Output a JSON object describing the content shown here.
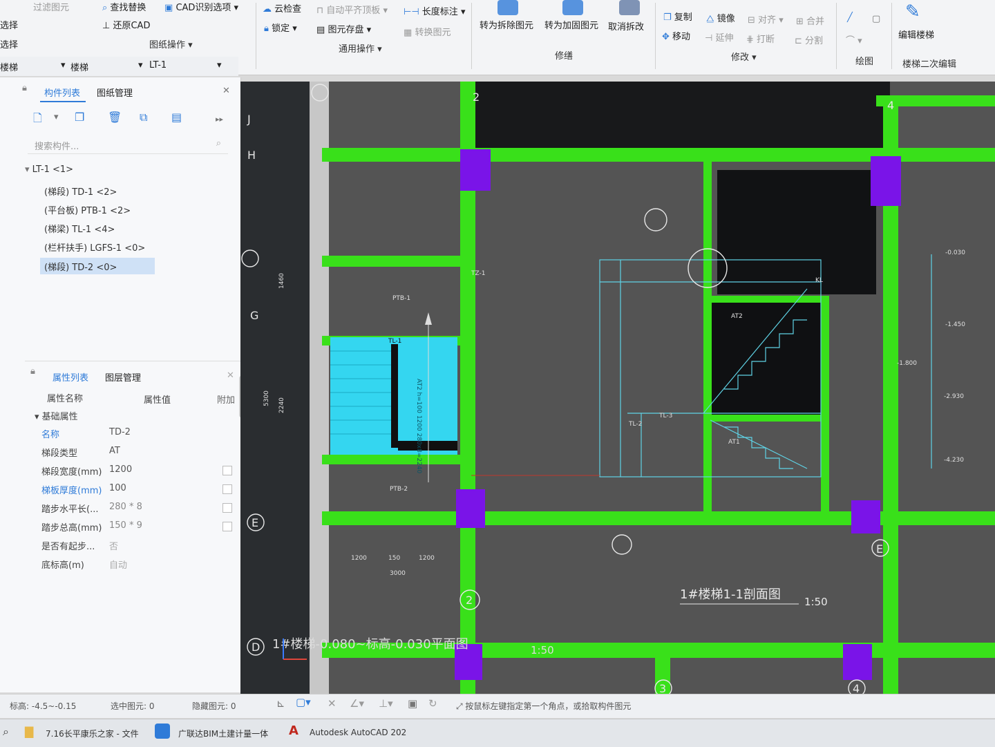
{
  "ribbon": {
    "top_left": [
      "过滤图元",
      "选择",
      "选择"
    ],
    "find_replace": "查找替换",
    "cad_options": "CAD识别选项",
    "restore_cad": "还原CAD",
    "drawing_ops": "图纸操作",
    "cloud_check": "云检查",
    "auto_slab": "自动平齐顶板",
    "length_dim": "长度标注",
    "lock": "锁定",
    "save_element": "图元存盘",
    "convert_element": "转换图元",
    "common_ops": "通用操作",
    "to_demolish": "转为拆除图元",
    "to_reinforce": "转为加固图元",
    "cancel_demolish": "取消拆改",
    "repair_group": "修缮",
    "copy": "复制",
    "mirror": "镜像",
    "align": "对齐",
    "merge": "合并",
    "move": "移动",
    "extend": "延伸",
    "break": "打断",
    "split": "分割",
    "modify_group": "修改",
    "draw_group": "绘图",
    "edit_stair": "编辑楼梯",
    "stair_edit_group": "楼梯二次编辑"
  },
  "selectors": {
    "type_partial": "楼梯",
    "category": "楼梯",
    "component": "LT-1"
  },
  "component_panel": {
    "tab_list": "构件列表",
    "tab_drawings": "图纸管理",
    "search_placeholder": "搜索构件...",
    "tree": [
      {
        "label": "LT-1 <1>"
      },
      {
        "label": "(梯段) TD-1 <2>"
      },
      {
        "label": "(平台板) PTB-1 <2>"
      },
      {
        "label": "(梯梁) TL-1 <4>"
      },
      {
        "label": "(栏杆扶手) LGFS-1 <0>"
      },
      {
        "label": "(梯段) TD-2 <0>"
      }
    ]
  },
  "property_panel": {
    "tab_props": "属性列表",
    "tab_layers": "图层管理",
    "col_name": "属性名称",
    "col_value": "属性值",
    "col_extra": "附加",
    "section": "基础属性",
    "rows": [
      {
        "name": "名称",
        "value": "TD-2"
      },
      {
        "name": "梯段类型",
        "value": "AT"
      },
      {
        "name": "梯段宽度(mm)",
        "value": "1200"
      },
      {
        "name": "梯板厚度(mm)",
        "value": "100"
      },
      {
        "name": "踏步水平长(...",
        "value": "280 * 8"
      },
      {
        "name": "踏步总高(mm)",
        "value": "150 * 9"
      },
      {
        "name": "是否有起步...",
        "value": "否"
      },
      {
        "name": "底标高(m)",
        "value": "自动"
      }
    ]
  },
  "canvas": {
    "axis_rows": [
      "J",
      "H",
      "G",
      "E",
      "D"
    ],
    "axis_cols": [
      "2",
      "4",
      "3",
      "E",
      "2",
      "4"
    ],
    "drawing_title": "1#楼梯1-1剖面图",
    "scale": "1:50",
    "bottom_title": "1#楼梯-0.080~标高-0.030平面图",
    "bottom_scale": "1:50",
    "labels": {
      "ptb1": "PTB-1",
      "ptb2": "PTB-2",
      "tz1": "TZ-1",
      "tl1": "TL-1",
      "tl2": "TL-2",
      "tl3": "TL-3",
      "at2": "AT2",
      "at1": "AT1",
      "kl": "KL",
      "stair_text": "AT2 h=100 1200 280x8=2240"
    },
    "dims": [
      "1200",
      "150",
      "1200",
      "3000",
      "1460",
      "2240",
      "5300"
    ],
    "elevations": [
      "-0.030",
      "-1.450",
      "-1.800",
      "-2.930",
      "-4.230"
    ]
  },
  "status": {
    "elevation": "标高: -4.5~-0.15",
    "selected": "选中图元: 0",
    "hidden": "隐藏图元: 0",
    "hint": "按鼠标左键指定第一个角点，或拾取构件图元"
  },
  "taskbar": {
    "item1": "7.16长平康乐之家 - 文件",
    "item2": "广联达BIM土建计量一体",
    "item3": "Autodesk AutoCAD 202"
  },
  "colors": {
    "canvas_bg": "#545454",
    "beam": "#39e01a",
    "column": "#7a14e8",
    "stair": "#34d6f0",
    "line": "#5fd3e6",
    "accent": "#2f7bd8"
  }
}
